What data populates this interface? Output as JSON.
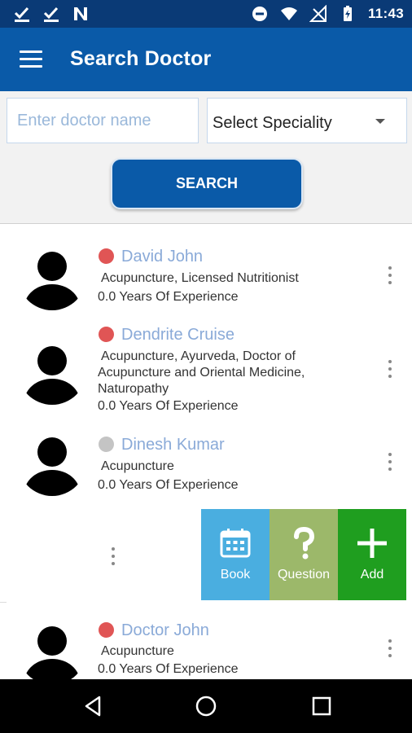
{
  "status_bar": {
    "time": "11:43"
  },
  "app_bar": {
    "title": "Search Doctor"
  },
  "search": {
    "name_placeholder": "Enter doctor name",
    "speciality_value": "Select Speciality",
    "button_label": "SEARCH"
  },
  "doctors": [
    {
      "name": "David John",
      "status": "busy",
      "status_color": "#e05555",
      "specialities": [
        "Acupuncture, Licensed Nutritionist"
      ],
      "experience": "0.0 Years Of Experience"
    },
    {
      "name": "Dendrite Cruise",
      "status": "busy",
      "status_color": "#e05555",
      "specialities": [
        "Acupuncture, Ayurveda, Doctor of",
        "Acupuncture and Oriental Medicine,",
        "Naturopathy"
      ],
      "experience": "0.0 Years Of Experience"
    },
    {
      "name": "Dinesh Kumar",
      "status": "offline",
      "status_color": "#c4c4c4",
      "specialities": [
        "Acupuncture"
      ],
      "experience": "0.0 Years Of Experience"
    },
    {
      "name": "Doctor John",
      "status": "busy",
      "status_color": "#e05555",
      "specialities": [
        "Acupuncture"
      ],
      "experience": "0.0 Years Of Experience"
    }
  ],
  "swipe_actions": [
    {
      "label": "Book",
      "icon": "calendar-icon",
      "color": "#4aaee0"
    },
    {
      "label": "Question",
      "icon": "question-icon",
      "color": "#9cb86a"
    },
    {
      "label": "Add",
      "icon": "plus-icon",
      "color": "#1f9e1f"
    }
  ],
  "colors": {
    "status_bar": "#0a3a76",
    "app_bar": "#0a5aa8",
    "name_text": "#8aaad8"
  }
}
